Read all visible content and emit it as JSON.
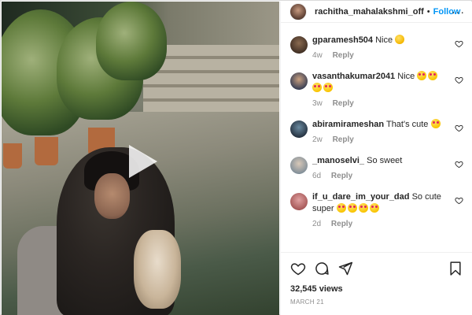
{
  "post": {
    "author": "rachitha_mahalakshmi_off",
    "separator": "•",
    "follow_label": "Follow",
    "more_label": "···"
  },
  "media": {
    "play_icon": "play-icon"
  },
  "comments": [
    {
      "user": "gparamesh504",
      "text": "Nice",
      "emoji": [
        "scream"
      ],
      "time": "4w",
      "reply": "Reply"
    },
    {
      "user": "vasanthakumar2041",
      "text": "Nice",
      "emoji": [
        "heart-eyes",
        "heart-eyes",
        "heart-eyes",
        "heart-eyes"
      ],
      "time": "3w",
      "reply": "Reply"
    },
    {
      "user": "abiramirameshan",
      "text": "That's cute",
      "emoji": [
        "heart-eyes"
      ],
      "time": "2w",
      "reply": "Reply"
    },
    {
      "user": "_manoselvi_",
      "text": "So sweet",
      "emoji": [],
      "time": "6d",
      "reply": "Reply"
    },
    {
      "user": "if_u_dare_im_your_dad",
      "text": "So cute super",
      "emoji": [
        "heart-eyes",
        "heart-eyes",
        "heart-eyes",
        "heart-eyes"
      ],
      "time": "2d",
      "reply": "Reply"
    }
  ],
  "actions": {
    "like_icon": "heart-icon",
    "comment_icon": "comment-icon",
    "share_icon": "share-icon",
    "save_icon": "bookmark-icon"
  },
  "stats": {
    "views": "32,545 views",
    "date": "MARCH 21"
  },
  "colors": {
    "accent": "#0095f6",
    "meta_text": "#8e8e8e",
    "border": "#efefef"
  }
}
